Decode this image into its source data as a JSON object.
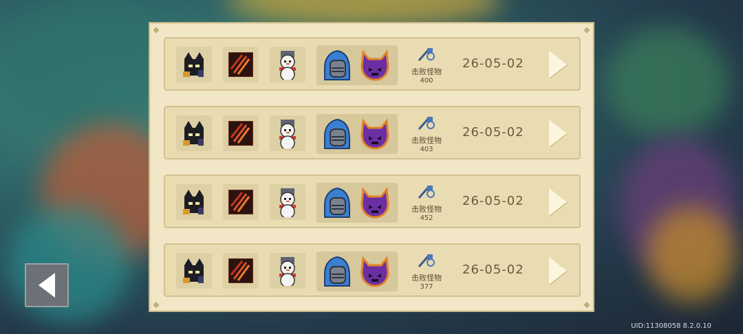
{
  "records": [
    {
      "kill_label": "击败怪物",
      "kills": "400",
      "date": "26-05-02"
    },
    {
      "kill_label": "击败怪物",
      "kills": "403",
      "date": "26-05-02"
    },
    {
      "kill_label": "击败怪物",
      "kills": "452",
      "date": "26-05-02"
    },
    {
      "kill_label": "击败怪物",
      "kills": "377",
      "date": "26-05-02"
    }
  ],
  "footer": {
    "uid": "UID:11308058 8.2.0.10"
  },
  "icons": {
    "character": "dark-knight-character-icon",
    "skill": "claw-slash-skill-icon",
    "pet": "snowman-pet-icon",
    "helmet": "blue-knight-helmet-icon",
    "boss": "purple-demon-mask-icon",
    "kills": "sword-kill-icon",
    "next": "arrow-right-icon",
    "back": "arrow-left-icon"
  }
}
